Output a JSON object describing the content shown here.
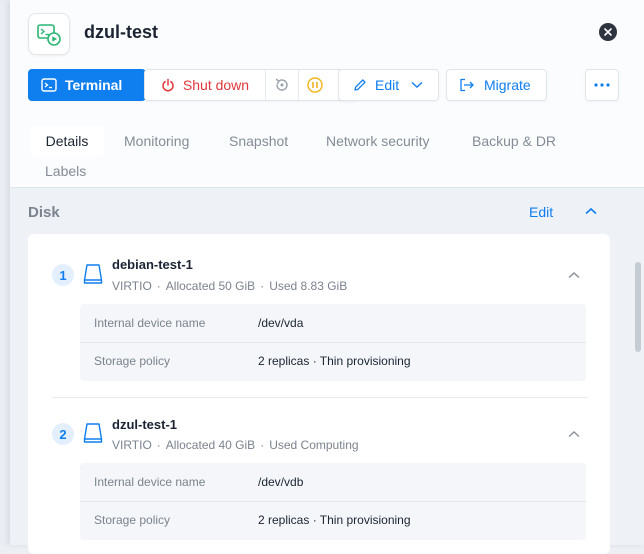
{
  "vm": {
    "name": "dzul-test"
  },
  "toolbar": {
    "terminal_label": "Terminal",
    "shutdown_label": "Shut down",
    "edit_label": "Edit",
    "migrate_label": "Migrate"
  },
  "tabs": [
    {
      "label": "Details",
      "active": true
    },
    {
      "label": "Monitoring"
    },
    {
      "label": "Snapshot"
    },
    {
      "label": "Network security"
    },
    {
      "label": "Backup & DR"
    },
    {
      "label": "Labels"
    }
  ],
  "disk_section": {
    "title": "Disk",
    "edit_label": "Edit"
  },
  "disks": [
    {
      "index": "1",
      "name": "debian-test-1",
      "bus": "VIRTIO",
      "allocated": "Allocated 50 GiB",
      "used": "Used 8.83 GiB",
      "device_label": "Internal device name",
      "device_value": "/dev/vda",
      "policy_label": "Storage policy",
      "policy_value": "2 replicas · Thin provisioning"
    },
    {
      "index": "2",
      "name": "dzul-test-1",
      "bus": "VIRTIO",
      "allocated": "Allocated 40 GiB",
      "used": "Used Computing",
      "device_label": "Internal device name",
      "device_value": "/dev/vdb",
      "policy_label": "Storage policy",
      "policy_value": "2 replicas · Thin provisioning"
    }
  ],
  "colors": {
    "primary": "#0f7ff0",
    "danger": "#e0383b",
    "warning": "#f2b31c",
    "success": "#2bb673"
  }
}
